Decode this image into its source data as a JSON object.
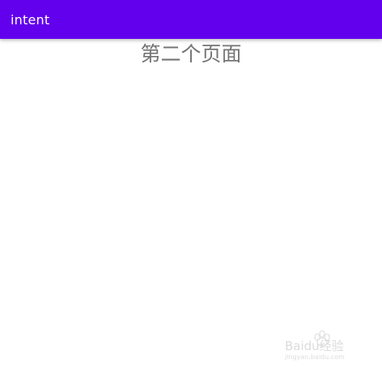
{
  "app_bar": {
    "title": "intent",
    "color": "#6200EE"
  },
  "main": {
    "text": "第二个页面"
  },
  "watermark": {
    "text": "Baidu经验",
    "subtext": "jingyan.baidu.com"
  }
}
